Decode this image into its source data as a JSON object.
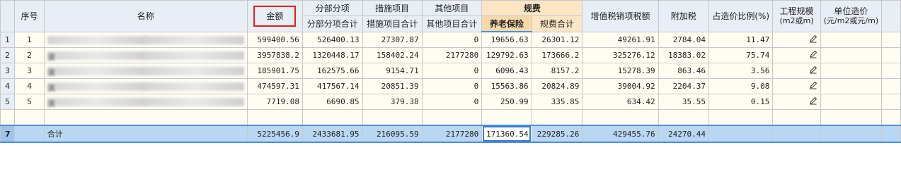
{
  "headers": {
    "seq": "序号",
    "name": "名称",
    "amount": "金额",
    "subitem_group": "分部分项",
    "subitem_total": "分部分项合计",
    "measure_group": "措施项目",
    "measure_total": "措施项目合计",
    "other_group": "其他项目",
    "other_total": "其他项目合计",
    "gf_group": "规费",
    "pension": "养老保险",
    "gf_total": "规费合计",
    "vat": "增值税销项税额",
    "surtax": "附加税",
    "ratio": "占造价比例(%)",
    "scale_line1": "工程规模",
    "scale_line2": "(m2或m)",
    "unit_cost_line1": "单位造价",
    "unit_cost_line2": "(元/m2或元/m)"
  },
  "rows": [
    {
      "no": "1",
      "seq": "1",
      "name_lead": "",
      "amount": "599400.56",
      "subitem": "526400.13",
      "measure": "27307.87",
      "other": "0",
      "pension": "19656.63",
      "gf_total": "26301.12",
      "vat": "49261.91",
      "surtax": "2784.04",
      "ratio": "11.47"
    },
    {
      "no": "2",
      "seq": "2",
      "name_lead": "滨",
      "amount": "3957838.2",
      "subitem": "1320448.17",
      "measure": "158402.24",
      "other": "2177280",
      "pension": "129792.63",
      "gf_total": "173666.2",
      "vat": "325276.12",
      "surtax": "18383.02",
      "ratio": "75.74"
    },
    {
      "no": "3",
      "seq": "3",
      "name_lead": "滨",
      "amount": "185901.75",
      "subitem": "162575.66",
      "measure": "9154.71",
      "other": "0",
      "pension": "6096.43",
      "gf_total": "8157.2",
      "vat": "15278.39",
      "surtax": "863.46",
      "ratio": "3.56"
    },
    {
      "no": "4",
      "seq": "4",
      "name_lead": "滨",
      "amount": "474597.31",
      "subitem": "417567.14",
      "measure": "20851.39",
      "other": "0",
      "pension": "15563.86",
      "gf_total": "20824.89",
      "vat": "39004.92",
      "surtax": "2204.37",
      "ratio": "9.08"
    },
    {
      "no": "5",
      "seq": "5",
      "name_lead": "滨",
      "amount": "7719.08",
      "subitem": "6690.85",
      "measure": "379.38",
      "other": "0",
      "pension": "250.99",
      "gf_total": "335.85",
      "vat": "634.42",
      "surtax": "35.55",
      "ratio": "0.15"
    }
  ],
  "total": {
    "no": "7",
    "label": "合计",
    "amount": "5225456.9",
    "subitem": "2433681.95",
    "measure": "216095.59",
    "other": "2177280",
    "pension": "171360.54",
    "gf_total": "229285.26",
    "vat": "429455.76",
    "surtax": "24270.44"
  },
  "colors": {
    "header_bg": "#e8eef6",
    "fee_header_bg": "#fbe5c4",
    "row_bg": "#fffdf2",
    "total_bg": "#b9d7f3",
    "highlight_box": "#e02020",
    "selection_border": "#3a7bd5"
  },
  "icons": {
    "edit": "pencil-icon"
  }
}
